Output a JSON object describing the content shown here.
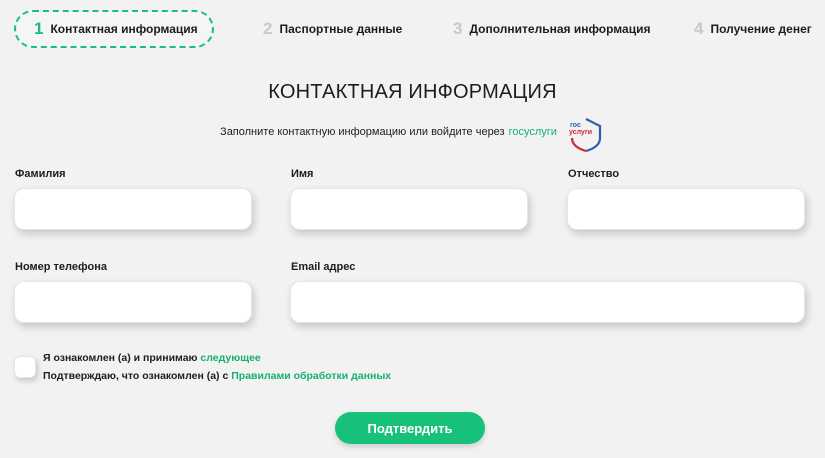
{
  "steps": [
    {
      "num": "1",
      "label": "Контактная информация"
    },
    {
      "num": "2",
      "label": "Паспортные данные"
    },
    {
      "num": "3",
      "label": "Дополнительная информация"
    },
    {
      "num": "4",
      "label": "Получение денег"
    }
  ],
  "active_step": 1,
  "heading": "КОНТАКТНАЯ ИНФОРМАЦИЯ",
  "subtitle": {
    "text": "Заполните контактную информацию или войдите через",
    "link": "госуслуги",
    "logo_top": "гос",
    "logo_bottom": "услуги"
  },
  "form": {
    "last_name": {
      "label": "Фамилия",
      "value": ""
    },
    "first_name": {
      "label": "Имя",
      "value": ""
    },
    "patronymic": {
      "label": "Отчество",
      "value": ""
    },
    "phone": {
      "label": "Номер телефона",
      "value": ""
    },
    "email": {
      "label": "Email адрес",
      "value": ""
    }
  },
  "consent": {
    "checked": false,
    "line1_text": "Я ознакомлен (а) и принимаю",
    "line1_link": "следующее",
    "line2_text": "Подтверждаю, что ознакомлен (а) с",
    "line2_link": "Правилами обработки данных"
  },
  "submit_label": "Подтвердить",
  "colors": {
    "accent": "#17c17a",
    "background": "#f2f2f2",
    "text": "#1d1d1d"
  }
}
